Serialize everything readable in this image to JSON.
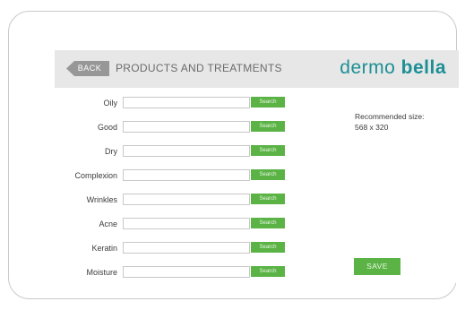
{
  "header": {
    "back_label": "BACK",
    "title": "PRODUCTS AND TREATMENTS",
    "logo_part1": "dermo",
    "logo_part2": "bella"
  },
  "form": {
    "search_label": "Search",
    "fields": [
      {
        "label": "Oily",
        "value": ""
      },
      {
        "label": "Good",
        "value": ""
      },
      {
        "label": "Dry",
        "value": ""
      },
      {
        "label": "Complexion",
        "value": ""
      },
      {
        "label": "Wrinkles",
        "value": ""
      },
      {
        "label": "Acne",
        "value": ""
      },
      {
        "label": "Keratin",
        "value": ""
      },
      {
        "label": "Moisture",
        "value": ""
      }
    ]
  },
  "note": {
    "line1": "Recommended size:",
    "line2": "568 x 320"
  },
  "save_label": "SAVE",
  "colors": {
    "brand": "#1c8f95",
    "button_green": "#5bb346",
    "header_bg": "#e7e7e7"
  }
}
